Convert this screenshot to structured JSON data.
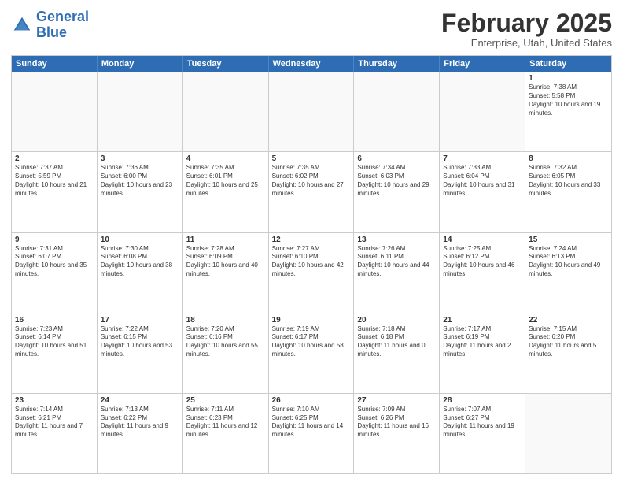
{
  "header": {
    "logo_general": "General",
    "logo_blue": "Blue",
    "month_title": "February 2025",
    "location": "Enterprise, Utah, United States"
  },
  "days_of_week": [
    "Sunday",
    "Monday",
    "Tuesday",
    "Wednesday",
    "Thursday",
    "Friday",
    "Saturday"
  ],
  "weeks": [
    [
      {
        "day": "",
        "text": ""
      },
      {
        "day": "",
        "text": ""
      },
      {
        "day": "",
        "text": ""
      },
      {
        "day": "",
        "text": ""
      },
      {
        "day": "",
        "text": ""
      },
      {
        "day": "",
        "text": ""
      },
      {
        "day": "1",
        "text": "Sunrise: 7:38 AM\nSunset: 5:58 PM\nDaylight: 10 hours and 19 minutes."
      }
    ],
    [
      {
        "day": "2",
        "text": "Sunrise: 7:37 AM\nSunset: 5:59 PM\nDaylight: 10 hours and 21 minutes."
      },
      {
        "day": "3",
        "text": "Sunrise: 7:36 AM\nSunset: 6:00 PM\nDaylight: 10 hours and 23 minutes."
      },
      {
        "day": "4",
        "text": "Sunrise: 7:35 AM\nSunset: 6:01 PM\nDaylight: 10 hours and 25 minutes."
      },
      {
        "day": "5",
        "text": "Sunrise: 7:35 AM\nSunset: 6:02 PM\nDaylight: 10 hours and 27 minutes."
      },
      {
        "day": "6",
        "text": "Sunrise: 7:34 AM\nSunset: 6:03 PM\nDaylight: 10 hours and 29 minutes."
      },
      {
        "day": "7",
        "text": "Sunrise: 7:33 AM\nSunset: 6:04 PM\nDaylight: 10 hours and 31 minutes."
      },
      {
        "day": "8",
        "text": "Sunrise: 7:32 AM\nSunset: 6:05 PM\nDaylight: 10 hours and 33 minutes."
      }
    ],
    [
      {
        "day": "9",
        "text": "Sunrise: 7:31 AM\nSunset: 6:07 PM\nDaylight: 10 hours and 35 minutes."
      },
      {
        "day": "10",
        "text": "Sunrise: 7:30 AM\nSunset: 6:08 PM\nDaylight: 10 hours and 38 minutes."
      },
      {
        "day": "11",
        "text": "Sunrise: 7:28 AM\nSunset: 6:09 PM\nDaylight: 10 hours and 40 minutes."
      },
      {
        "day": "12",
        "text": "Sunrise: 7:27 AM\nSunset: 6:10 PM\nDaylight: 10 hours and 42 minutes."
      },
      {
        "day": "13",
        "text": "Sunrise: 7:26 AM\nSunset: 6:11 PM\nDaylight: 10 hours and 44 minutes."
      },
      {
        "day": "14",
        "text": "Sunrise: 7:25 AM\nSunset: 6:12 PM\nDaylight: 10 hours and 46 minutes."
      },
      {
        "day": "15",
        "text": "Sunrise: 7:24 AM\nSunset: 6:13 PM\nDaylight: 10 hours and 49 minutes."
      }
    ],
    [
      {
        "day": "16",
        "text": "Sunrise: 7:23 AM\nSunset: 6:14 PM\nDaylight: 10 hours and 51 minutes."
      },
      {
        "day": "17",
        "text": "Sunrise: 7:22 AM\nSunset: 6:15 PM\nDaylight: 10 hours and 53 minutes."
      },
      {
        "day": "18",
        "text": "Sunrise: 7:20 AM\nSunset: 6:16 PM\nDaylight: 10 hours and 55 minutes."
      },
      {
        "day": "19",
        "text": "Sunrise: 7:19 AM\nSunset: 6:17 PM\nDaylight: 10 hours and 58 minutes."
      },
      {
        "day": "20",
        "text": "Sunrise: 7:18 AM\nSunset: 6:18 PM\nDaylight: 11 hours and 0 minutes."
      },
      {
        "day": "21",
        "text": "Sunrise: 7:17 AM\nSunset: 6:19 PM\nDaylight: 11 hours and 2 minutes."
      },
      {
        "day": "22",
        "text": "Sunrise: 7:15 AM\nSunset: 6:20 PM\nDaylight: 11 hours and 5 minutes."
      }
    ],
    [
      {
        "day": "23",
        "text": "Sunrise: 7:14 AM\nSunset: 6:21 PM\nDaylight: 11 hours and 7 minutes."
      },
      {
        "day": "24",
        "text": "Sunrise: 7:13 AM\nSunset: 6:22 PM\nDaylight: 11 hours and 9 minutes."
      },
      {
        "day": "25",
        "text": "Sunrise: 7:11 AM\nSunset: 6:23 PM\nDaylight: 11 hours and 12 minutes."
      },
      {
        "day": "26",
        "text": "Sunrise: 7:10 AM\nSunset: 6:25 PM\nDaylight: 11 hours and 14 minutes."
      },
      {
        "day": "27",
        "text": "Sunrise: 7:09 AM\nSunset: 6:26 PM\nDaylight: 11 hours and 16 minutes."
      },
      {
        "day": "28",
        "text": "Sunrise: 7:07 AM\nSunset: 6:27 PM\nDaylight: 11 hours and 19 minutes."
      },
      {
        "day": "",
        "text": ""
      }
    ]
  ]
}
